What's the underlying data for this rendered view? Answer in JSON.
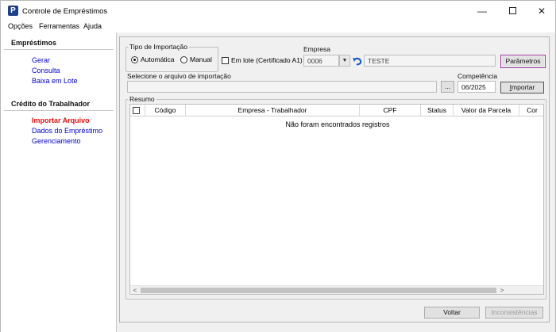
{
  "window": {
    "title": "Controle de Empréstimos",
    "icon_letter": "P",
    "minimize_glyph": "—",
    "close_glyph": "✕"
  },
  "menu": [
    "Opções",
    "Ferramentas",
    "Ajuda"
  ],
  "sidebar": {
    "section1": {
      "heading": "Empréstimos",
      "items": [
        "Gerar",
        "Consulta",
        "Baixa em Lote"
      ]
    },
    "section2": {
      "heading": "Crédito do Trabalhador",
      "items": [
        "Importar Arquivo",
        "Dados do Empréstimo",
        "Gerenciamento"
      ]
    },
    "active_item": "Importar Arquivo",
    "colors": {
      "link": "#0000d8",
      "active": "#e81010"
    }
  },
  "import_type": {
    "legend": "Tipo de Importação",
    "options": [
      "Automática",
      "Manual"
    ],
    "selected": "Automática"
  },
  "batch": {
    "label": "Em lote (Certificado A1)",
    "checked": false
  },
  "company": {
    "label": "Empresa",
    "code": "0006",
    "name": "TESTE",
    "dropdown_glyph": "▼",
    "undo_icon": "undo-arrow-icon"
  },
  "buttons": {
    "parametros": "Parâmetros",
    "browse": "...",
    "importar_prefix": "",
    "importar_hotkey": "I",
    "importar_suffix": "mportar",
    "voltar": "Voltar",
    "inconsistencias": "Inconsistências"
  },
  "file_select": {
    "label": "Selecione o arquivo de importação",
    "value": ""
  },
  "competencia": {
    "label": "Competência",
    "value": "06/2025"
  },
  "summary": {
    "legend": "Resumo",
    "columns": [
      "Código",
      "Empresa - Trabalhador",
      "CPF",
      "Status",
      "Valor da Parcela",
      "Cor"
    ],
    "empty_message": "Não foram encontrados registros",
    "rows": []
  },
  "scrollbar": {
    "left_glyph": "<",
    "right_glyph": ">"
  }
}
